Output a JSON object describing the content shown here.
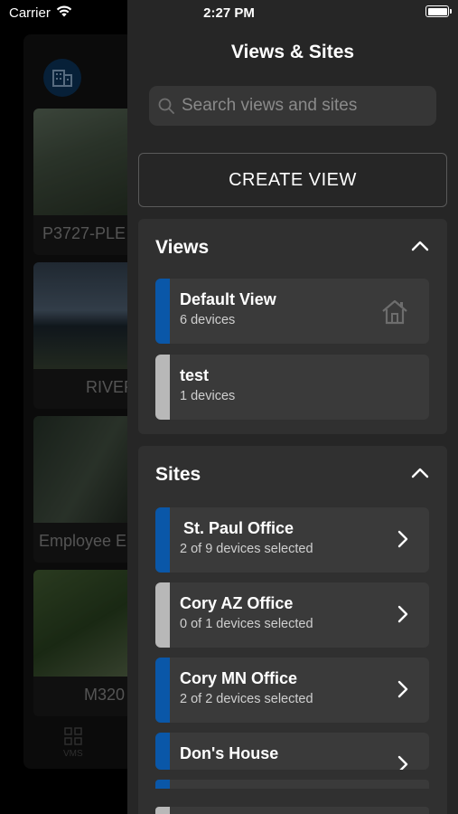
{
  "status_bar": {
    "carrier": "Carrier",
    "time": "2:27 PM"
  },
  "background_app": {
    "cameras": [
      {
        "label": "P3727-PLE"
      },
      {
        "label": "RIVER"
      },
      {
        "label": "Employee E"
      },
      {
        "label": "M320"
      }
    ],
    "nav": {
      "label": "VMS"
    }
  },
  "drawer": {
    "title": "Views & Sites",
    "search": {
      "placeholder": "Search views and sites",
      "value": ""
    },
    "create_button": "CREATE VIEW",
    "views": {
      "title": "Views",
      "items": [
        {
          "name": "Default View",
          "subtitle": "6 devices",
          "indicator": "blue",
          "icon": "home-icon"
        },
        {
          "name": "test",
          "subtitle": "1 devices",
          "indicator": "grey"
        }
      ]
    },
    "sites": {
      "title": "Sites",
      "items": [
        {
          "name": "St. Paul Office",
          "subtitle": "2 of 9 devices selected",
          "indicator": "blue",
          "icon": "chevron-right-icon"
        },
        {
          "name": "Cory AZ Office",
          "subtitle": "0 of 1 devices selected",
          "indicator": "grey",
          "icon": "chevron-right-icon"
        },
        {
          "name": "Cory MN Office",
          "subtitle": "2 of 2 devices selected",
          "indicator": "blue",
          "icon": "chevron-right-icon"
        },
        {
          "name": "Don's House",
          "subtitle": "",
          "indicator": "blue",
          "icon": "chevron-right-icon"
        }
      ]
    }
  },
  "colors": {
    "accent_blue": "#0a57a8",
    "inactive_grey": "#b8b8b8",
    "drawer_bg": "#262626",
    "card_bg": "#3a3a3a"
  }
}
